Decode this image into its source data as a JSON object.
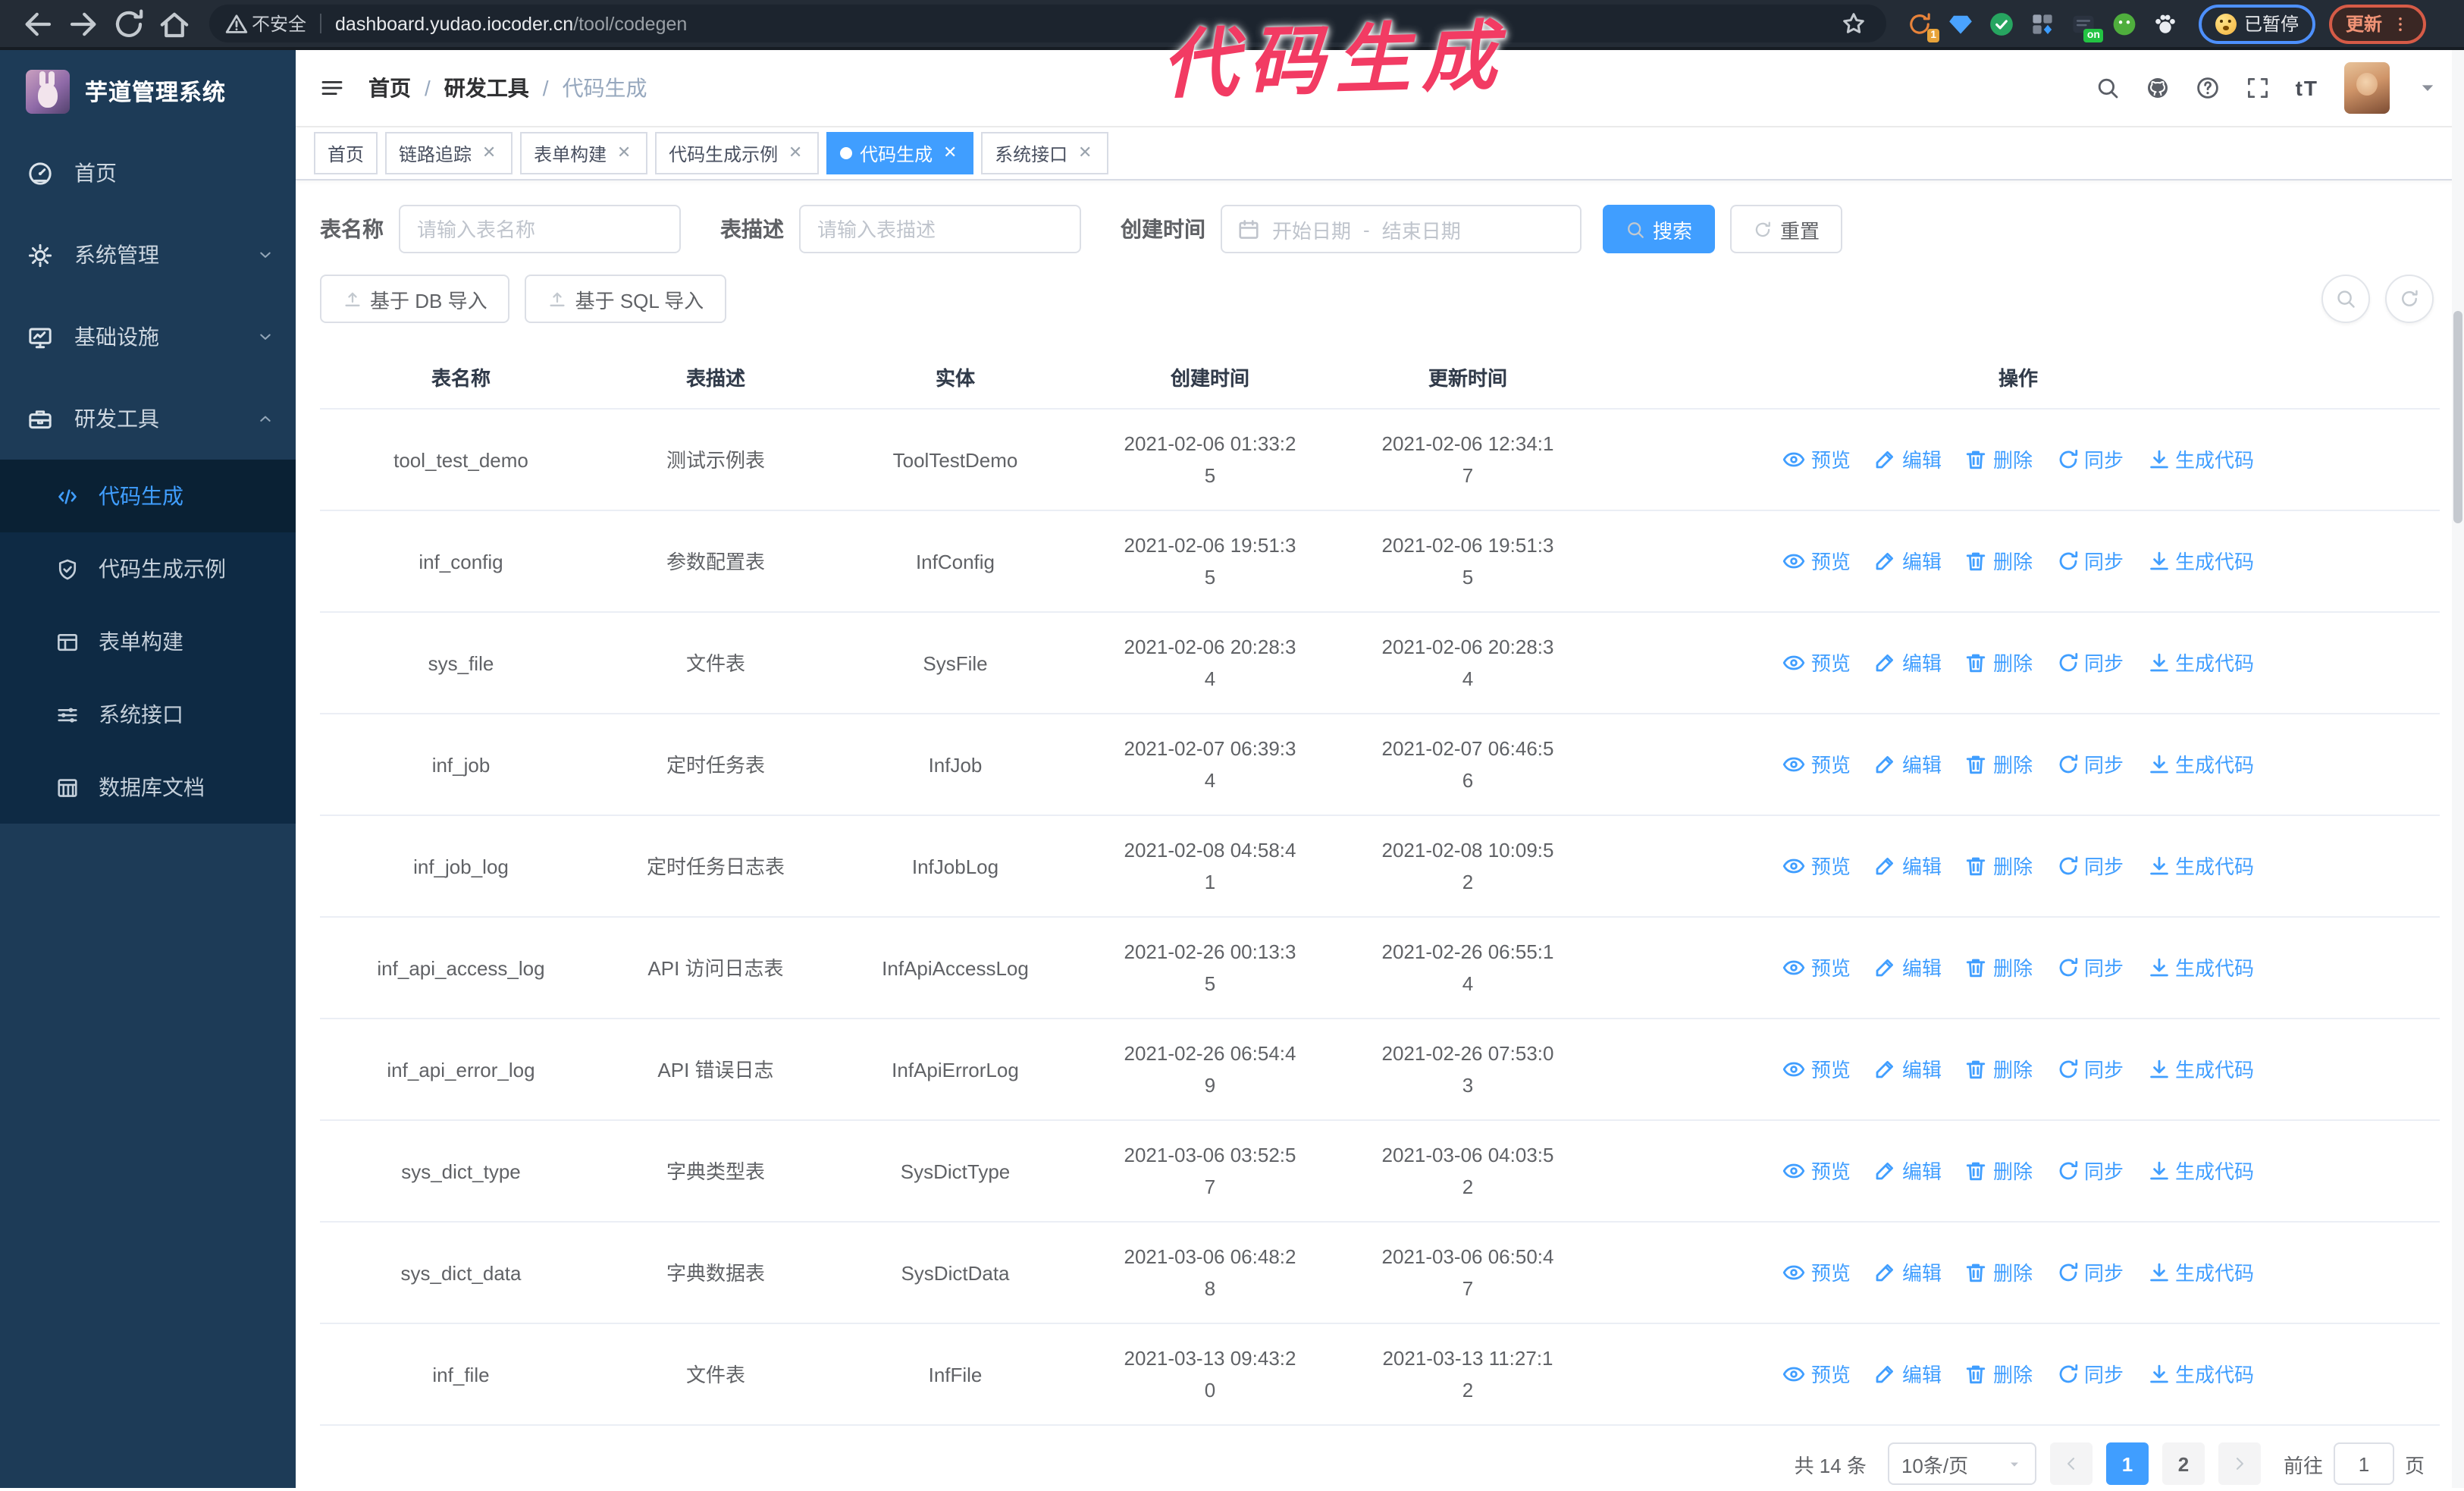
{
  "browser": {
    "security_label": "不安全",
    "url_host": "dashboard.yudao.iocoder.cn",
    "url_path": "/tool/codegen",
    "paused_label": "已暂停",
    "update_label": "更新",
    "extensions": [
      {
        "icon": "circular-arrow-icon",
        "badge": "1",
        "badge_bg": "#e8a33a"
      },
      {
        "icon": "diamond-icon"
      },
      {
        "icon": "check-circle-icon"
      },
      {
        "icon": "grid-icon"
      },
      {
        "icon": "switch-icon",
        "badge": "on",
        "badge_bg": "#23c343"
      },
      {
        "icon": "frog-icon"
      },
      {
        "icon": "paw-icon"
      }
    ]
  },
  "annotation": {
    "text": "代码生成",
    "color": "#f23b63"
  },
  "sidebar": {
    "logo_title": "芋道管理系统",
    "items": [
      {
        "label": "首页",
        "icon": "dashboard-icon"
      },
      {
        "label": "系统管理",
        "icon": "gear-icon",
        "chevron": "down"
      },
      {
        "label": "基础设施",
        "icon": "monitor-icon",
        "chevron": "down"
      },
      {
        "label": "研发工具",
        "icon": "toolbox-icon",
        "chevron": "up"
      }
    ],
    "subitems": [
      {
        "label": "代码生成",
        "icon": "code-icon",
        "active": true
      },
      {
        "label": "代码生成示例",
        "icon": "shield-check-icon"
      },
      {
        "label": "表单构建",
        "icon": "form-icon"
      },
      {
        "label": "系统接口",
        "icon": "sliders-icon"
      },
      {
        "label": "数据库文档",
        "icon": "database-icon"
      }
    ]
  },
  "header": {
    "breadcrumb": [
      "首页",
      "研发工具",
      "代码生成"
    ],
    "font_size_glyph": "tT"
  },
  "tabs": [
    {
      "label": "首页",
      "closable": false,
      "active": false
    },
    {
      "label": "链路追踪",
      "closable": true,
      "active": false
    },
    {
      "label": "表单构建",
      "closable": true,
      "active": false
    },
    {
      "label": "代码生成示例",
      "closable": true,
      "active": false
    },
    {
      "label": "代码生成",
      "closable": true,
      "active": true
    },
    {
      "label": "系统接口",
      "closable": true,
      "active": false
    }
  ],
  "filters": {
    "table_name_label": "表名称",
    "table_name_placeholder": "请输入表名称",
    "table_desc_label": "表描述",
    "table_desc_placeholder": "请输入表描述",
    "create_time_label": "创建时间",
    "start_placeholder": "开始日期",
    "range_separator": "-",
    "end_placeholder": "结束日期",
    "search_label": "搜索",
    "reset_label": "重置"
  },
  "toolbar": {
    "import_db_label": "基于 DB 导入",
    "import_sql_label": "基于 SQL 导入"
  },
  "table": {
    "columns": [
      "表名称",
      "表描述",
      "实体",
      "创建时间",
      "更新时间",
      "操作"
    ],
    "actions": [
      {
        "label": "预览",
        "icon": "eye-icon"
      },
      {
        "label": "编辑",
        "icon": "pen-icon"
      },
      {
        "label": "删除",
        "icon": "trash-icon"
      },
      {
        "label": "同步",
        "icon": "sync-icon"
      },
      {
        "label": "生成代码",
        "icon": "download-icon"
      }
    ],
    "rows": [
      {
        "name": "tool_test_demo",
        "description": "测试示例表",
        "entity": "ToolTestDemo",
        "created": "2021-02-06 01:33:25",
        "updated": "2021-02-06 12:34:17"
      },
      {
        "name": "inf_config",
        "description": "参数配置表",
        "entity": "InfConfig",
        "created": "2021-02-06 19:51:35",
        "updated": "2021-02-06 19:51:35"
      },
      {
        "name": "sys_file",
        "description": "文件表",
        "entity": "SysFile",
        "created": "2021-02-06 20:28:34",
        "updated": "2021-02-06 20:28:34"
      },
      {
        "name": "inf_job",
        "description": "定时任务表",
        "entity": "InfJob",
        "created": "2021-02-07 06:39:34",
        "updated": "2021-02-07 06:46:56"
      },
      {
        "name": "inf_job_log",
        "description": "定时任务日志表",
        "entity": "InfJobLog",
        "created": "2021-02-08 04:58:41",
        "updated": "2021-02-08 10:09:52"
      },
      {
        "name": "inf_api_access_log",
        "description": "API 访问日志表",
        "entity": "InfApiAccessLog",
        "created": "2021-02-26 00:13:35",
        "updated": "2021-02-26 06:55:14"
      },
      {
        "name": "inf_api_error_log",
        "description": "API 错误日志",
        "entity": "InfApiErrorLog",
        "created": "2021-02-26 06:54:49",
        "updated": "2021-02-26 07:53:03"
      },
      {
        "name": "sys_dict_type",
        "description": "字典类型表",
        "entity": "SysDictType",
        "created": "2021-03-06 03:52:57",
        "updated": "2021-03-06 04:03:52"
      },
      {
        "name": "sys_dict_data",
        "description": "字典数据表",
        "entity": "SysDictData",
        "created": "2021-03-06 06:48:28",
        "updated": "2021-03-06 06:50:47"
      },
      {
        "name": "inf_file",
        "description": "文件表",
        "entity": "InfFile",
        "created": "2021-03-13 09:43:20",
        "updated": "2021-03-13 11:27:12"
      }
    ]
  },
  "pagination": {
    "total": "共 14 条",
    "page_size": "10条/页",
    "pages": [
      "1",
      "2"
    ],
    "active_page": "1",
    "goto_label": "前往",
    "goto_value": "1",
    "goto_unit": "页"
  },
  "colors": {
    "primary": "#409eff",
    "sidebar_bg": "#1d3b57",
    "submenu_bg": "#0e2a44",
    "chrome_bg": "#242c36",
    "annotation": "#f23b63",
    "update_chip_border": "#d65b47",
    "paused_chip_border": "#4d90fe"
  }
}
